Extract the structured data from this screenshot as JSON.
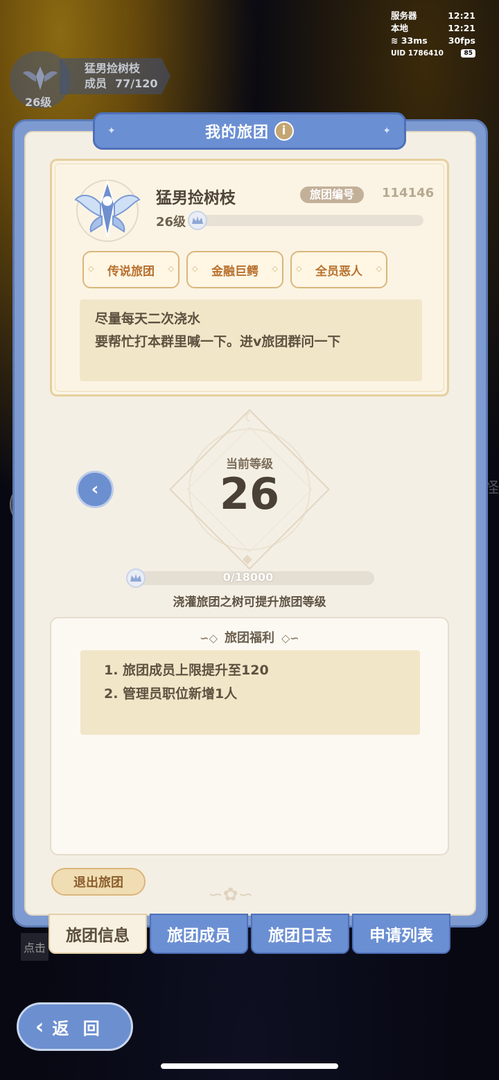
{
  "status": {
    "server_label": "服务器",
    "server_time": "12:21",
    "local_label": "本地",
    "local_time": "12:21",
    "ping": "33ms",
    "fps": "30fps",
    "uid": "UID 1786410",
    "battery": "85"
  },
  "hud": {
    "guild_name": "猛男捡树枝",
    "members_label": "成员",
    "members_count": "77/120",
    "level": "26级"
  },
  "panel": {
    "title": "我的旅团",
    "info_icon": "i"
  },
  "guild": {
    "name": "猛男捡树枝",
    "id_label": "旅团编号",
    "id": "114146",
    "level": "26级",
    "level_progress": 0.0,
    "tags": [
      "传说旅团",
      "金融巨鳄",
      "全员恶人"
    ],
    "description": [
      "尽量每天二次浇水",
      "要帮忙打本群里喊一下。进v旅团群问一下"
    ]
  },
  "level_panel": {
    "label": "当前等级",
    "value": "26",
    "progress_text": "0/18000",
    "progress": 0.0,
    "hint": "浇灌旅团之树可提升旅团等级"
  },
  "benefits": {
    "title": "旅团福利",
    "items": [
      "1.  旅团成员上限提升至120",
      "2.  管理员职位新增1人"
    ]
  },
  "quit_label": "退出旅团",
  "tabs": [
    "旅团信息",
    "旅团成员",
    "旅团日志",
    "申请列表"
  ],
  "back_label": "返 回",
  "bg_hint": "点击",
  "right_edge_char": "怪",
  "colors": {
    "blue": "#6b8fd3",
    "cream": "#f4efe4",
    "gold": "#d9b67c"
  }
}
